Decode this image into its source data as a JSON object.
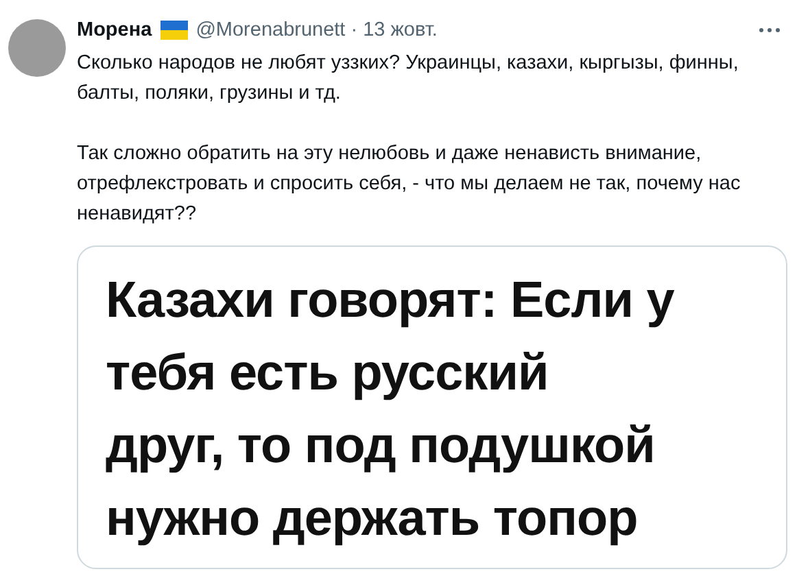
{
  "tweet": {
    "display_name": "Морена",
    "handle": "@Morenabrunett",
    "separator": "·",
    "date": "13 жовт.",
    "paragraphs": [
      "Сколько народов не любят уззких? Украинцы, казахи, кыргызы, финны, балты, поляки, грузины и тд.",
      "Так сложно обратить на эту нелюбовь и даже ненависть внимание, отрефлекстровать и спросить себя, - что мы делаем не так, почему нас ненавидят??"
    ],
    "image_lines": [
      "Казахи говорят: Если у",
      "тебя есть русский",
      "друг, то под подушкой",
      "нужно держать топор"
    ]
  }
}
